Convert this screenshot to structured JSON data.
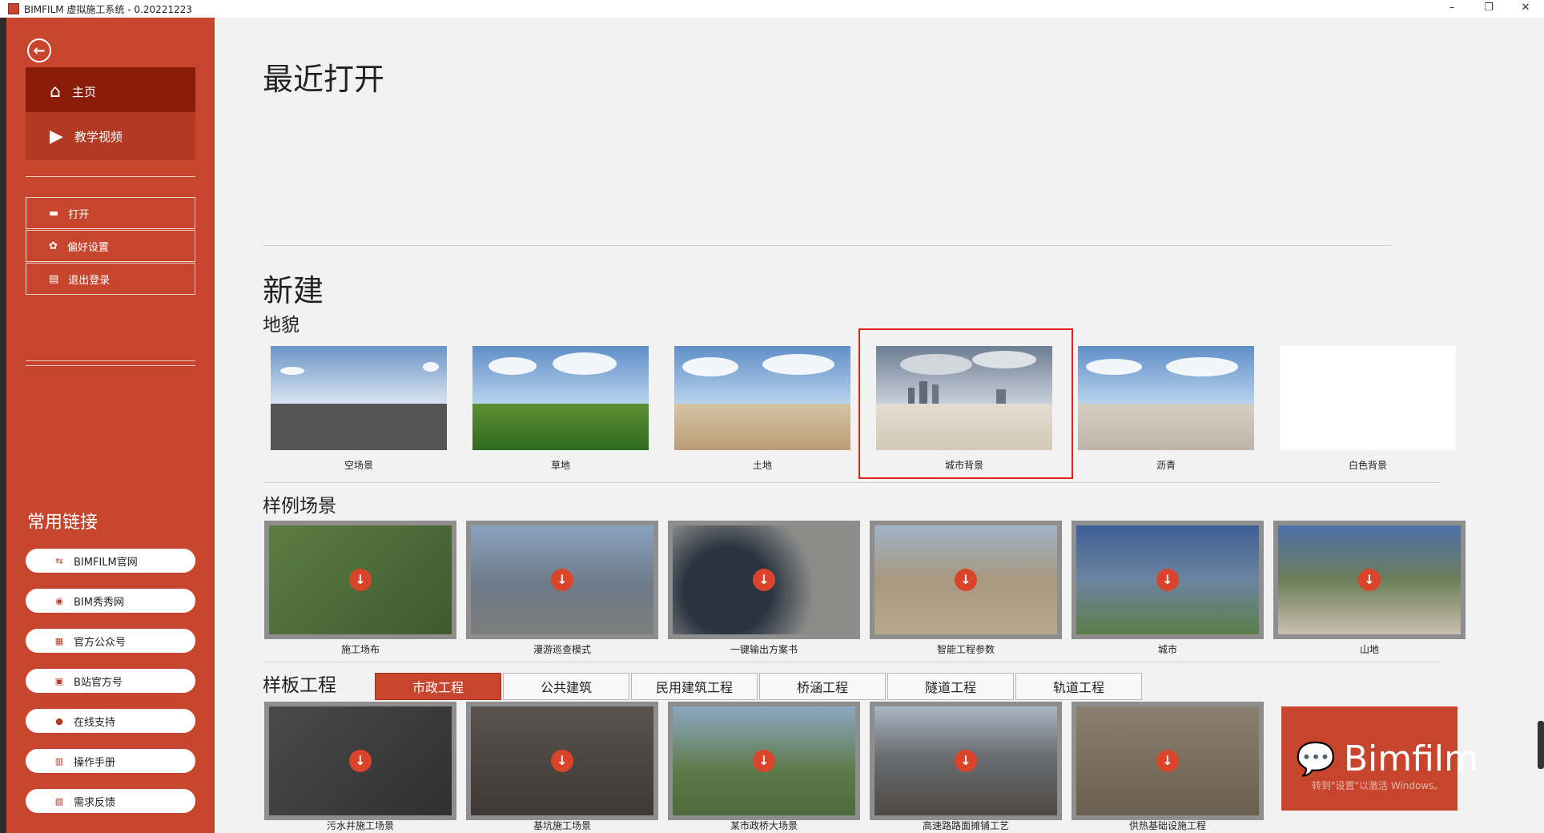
{
  "window": {
    "title": "BIMFILM 虚拟施工系统 - 0.20221223",
    "min": "–",
    "restore": "❐",
    "close": "✕"
  },
  "sidebar": {
    "nav": [
      {
        "label": "主页",
        "icon": "home-icon",
        "active": true
      },
      {
        "label": "教学视频",
        "icon": "video-icon",
        "active": false
      }
    ],
    "actions": [
      {
        "label": "打开",
        "icon": "folder-icon"
      },
      {
        "label": "偏好设置",
        "icon": "gear-icon"
      },
      {
        "label": "退出登录",
        "icon": "logout-icon"
      }
    ],
    "links_title": "常用链接",
    "links": [
      {
        "label": "BIMFILM官网",
        "icon": "website-icon"
      },
      {
        "label": "BIM秀秀网",
        "icon": "globe-icon"
      },
      {
        "label": "官方公众号",
        "icon": "qrcode-icon"
      },
      {
        "label": "B站官方号",
        "icon": "bilibili-icon"
      },
      {
        "label": "在线支持",
        "icon": "chat-icon"
      },
      {
        "label": "操作手册",
        "icon": "book-icon"
      },
      {
        "label": "需求反馈",
        "icon": "feedback-icon"
      }
    ]
  },
  "main": {
    "recent_title": "最近打开",
    "new_title": "新建",
    "terrain_title": "地貌",
    "terrains": [
      {
        "label": "空场景",
        "ground": "#555555"
      },
      {
        "label": "草地",
        "ground": "#3f7a26"
      },
      {
        "label": "土地",
        "ground": "#c2ab8a"
      },
      {
        "label": "城市背景",
        "ground": "#d9d2c4"
      },
      {
        "label": "沥青",
        "ground": "#c7c0b3"
      },
      {
        "label": "白色背景",
        "ground": "#ffffff"
      }
    ],
    "samples_title": "样例场景",
    "samples": [
      {
        "label": "施工场布",
        "bg": "#4d6b3a"
      },
      {
        "label": "漫游巡查模式",
        "bg": "#6d7a88"
      },
      {
        "label": "一键输出方案书",
        "bg": "#5a6672"
      },
      {
        "label": "智能工程参数",
        "bg": "#9a8a74"
      },
      {
        "label": "城市",
        "bg": "#5d7694"
      },
      {
        "label": "山地",
        "bg": "#6d7f5a"
      }
    ],
    "template_title": "样板工程",
    "tabs": [
      "市政工程",
      "公共建筑",
      "民用建筑工程",
      "桥涵工程",
      "隧道工程",
      "轨道工程"
    ],
    "templates": [
      {
        "label": "污水井施工场景",
        "bg": "#3b3b3b"
      },
      {
        "label": "基坑施工场景",
        "bg": "#4a4440"
      },
      {
        "label": "某市政桥大场景",
        "bg": "#5c7a48"
      },
      {
        "label": "高速路路面摊铺工艺",
        "bg": "#6a6e72"
      },
      {
        "label": "供热基础设施工程",
        "bg": "#6a5e50"
      }
    ],
    "brand_text": "Bimfilm",
    "watermark": "转到\"设置\"以激活 Windows。"
  }
}
